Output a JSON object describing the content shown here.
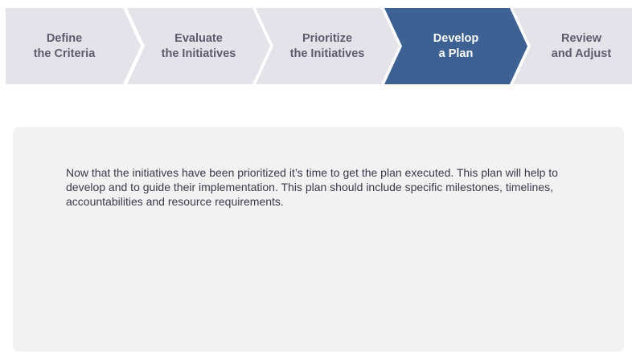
{
  "steps": [
    {
      "line1": "Define",
      "line2": "the Criteria",
      "state": "inactive"
    },
    {
      "line1": "Evaluate",
      "line2": "the Initiatives",
      "state": "inactive"
    },
    {
      "line1": "Prioritize",
      "line2": "the Initiatives",
      "state": "inactive"
    },
    {
      "line1": "Develop",
      "line2": "a Plan",
      "state": "active"
    },
    {
      "line1": "Review",
      "line2": "and Adjust",
      "state": "inactive"
    }
  ],
  "panel": {
    "text": "Now that the initiatives have been prioritized it’s time to get the plan executed. This plan will help to develop and to guide their implementation. This plan should include specific milestones, timelines, accountabilities and resource requirements."
  },
  "colors": {
    "active_step": "#3c6192",
    "inactive_step": "#e4e3ea",
    "inactive_text": "#5c5c6e",
    "panel_bg": "#f2f2f3",
    "body_text": "#3a3a4a"
  }
}
